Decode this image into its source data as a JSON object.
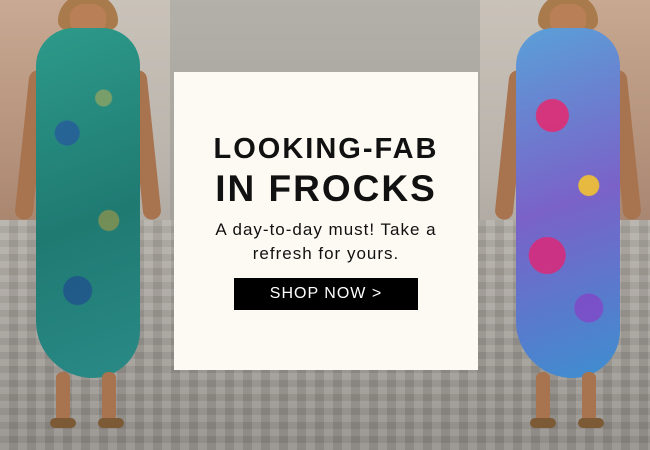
{
  "banner": {
    "headline_line1": "LOOKING-FAB",
    "headline_line2": "IN FROCKS",
    "subtext": "A day-to-day must! Take a refresh for yours.",
    "cta_label": "SHOP NOW >"
  },
  "colors": {
    "card_bg": "#fdfaf3",
    "cta_bg": "#000000",
    "cta_text": "#ffffff",
    "text": "#111111"
  }
}
